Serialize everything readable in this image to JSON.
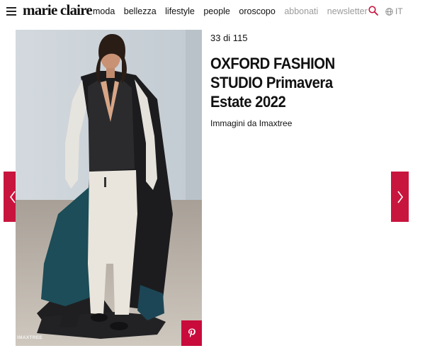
{
  "header": {
    "logo": "marie claire",
    "nav": [
      {
        "label": "moda",
        "state": "active"
      },
      {
        "label": "bellezza",
        "state": "active"
      },
      {
        "label": "lifestyle",
        "state": "active"
      },
      {
        "label": "people",
        "state": "active"
      },
      {
        "label": "oroscopo",
        "state": "active"
      },
      {
        "label": "abbonati",
        "state": "muted"
      },
      {
        "label": "newsletter",
        "state": "muted"
      }
    ],
    "language": "IT",
    "icons": {
      "menu": "hamburger-icon",
      "search": "search-icon",
      "language": "globe-icon"
    }
  },
  "gallery": {
    "counter": "33 di 115",
    "title_bold": "OXFORD FASHION STUDIO",
    "title_regular": "Primavera Estate 2022",
    "subtitle": "Immagini da Imaxtree",
    "image_alt": "runway look",
    "credit": "IMAXTREE",
    "icons": {
      "prev": "chevron-left-icon",
      "next": "chevron-right-icon",
      "share": "pinterest-icon"
    }
  },
  "colors": {
    "accent": "#c8153e",
    "pinterest": "#c90b3c",
    "muted_nav": "#9b9b9b"
  }
}
